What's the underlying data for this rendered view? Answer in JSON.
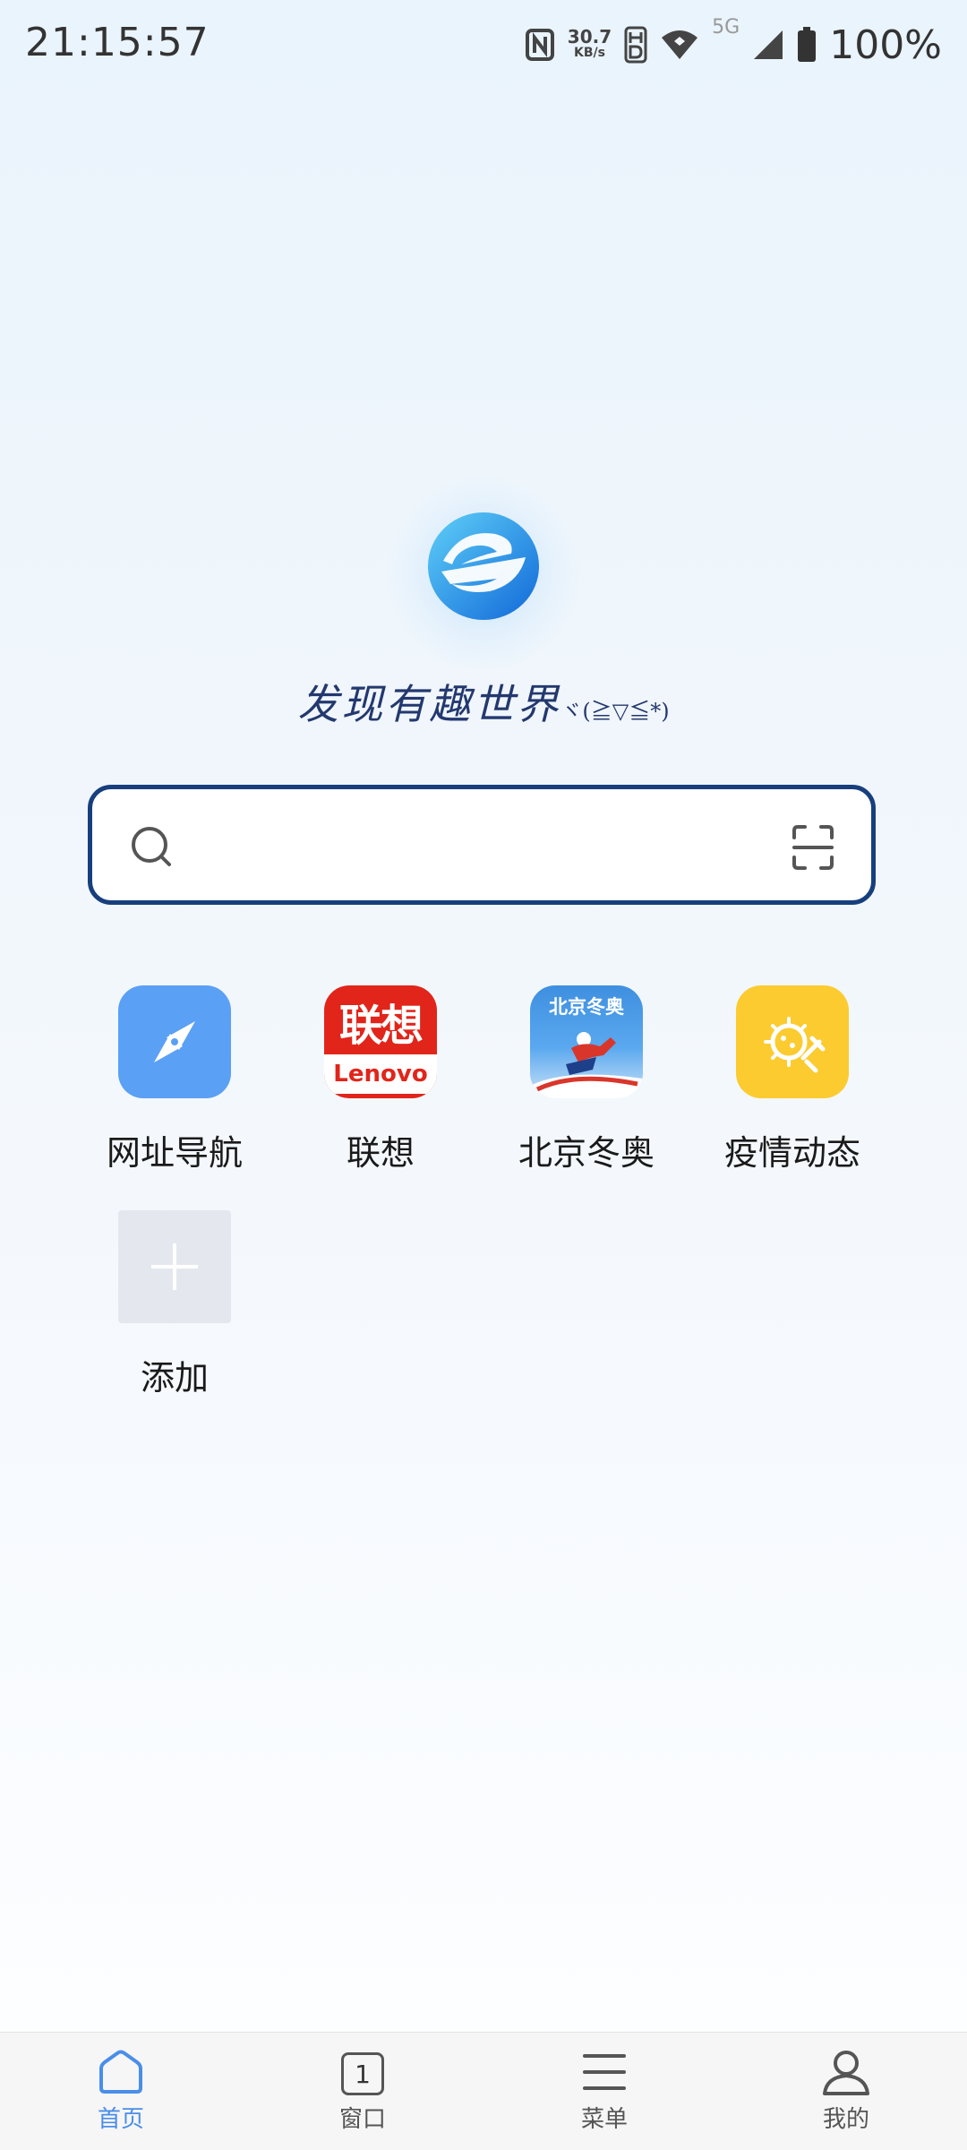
{
  "status_bar": {
    "time": "21:15:57",
    "net_speed_value": "30.7",
    "net_speed_unit": "KB/s",
    "network_type": "5G",
    "battery": "100%"
  },
  "home": {
    "slogan": "发现有趣世界",
    "slogan_emoticon": "ヾ(≧▽≦*)",
    "search": {
      "value": "",
      "placeholder": ""
    }
  },
  "shortcuts": [
    {
      "label": "网址导航",
      "icon": "compass-icon",
      "color": "#5aa0f5"
    },
    {
      "label": "联想",
      "icon": "lenovo-logo",
      "logo_text_cn": "联想",
      "logo_text_en": "Lenovo",
      "color": "#e1251b"
    },
    {
      "label": "北京冬奥",
      "icon": "beijing-olympics-icon",
      "logo_text": "北京冬奥",
      "color": "#3e8fe0"
    },
    {
      "label": "疫情动态",
      "icon": "virus-icon",
      "color": "#fbcb30"
    },
    {
      "label": "添加",
      "icon": "plus-icon",
      "color": "#e4e8ee"
    }
  ],
  "bottom_nav": {
    "items": [
      {
        "label": "首页",
        "icon": "home-icon",
        "active": true
      },
      {
        "label": "窗口",
        "icon": "window-icon",
        "count": "1"
      },
      {
        "label": "菜单",
        "icon": "menu-icon"
      },
      {
        "label": "我的",
        "icon": "user-icon"
      }
    ],
    "active_color": "#4a8ee8"
  }
}
